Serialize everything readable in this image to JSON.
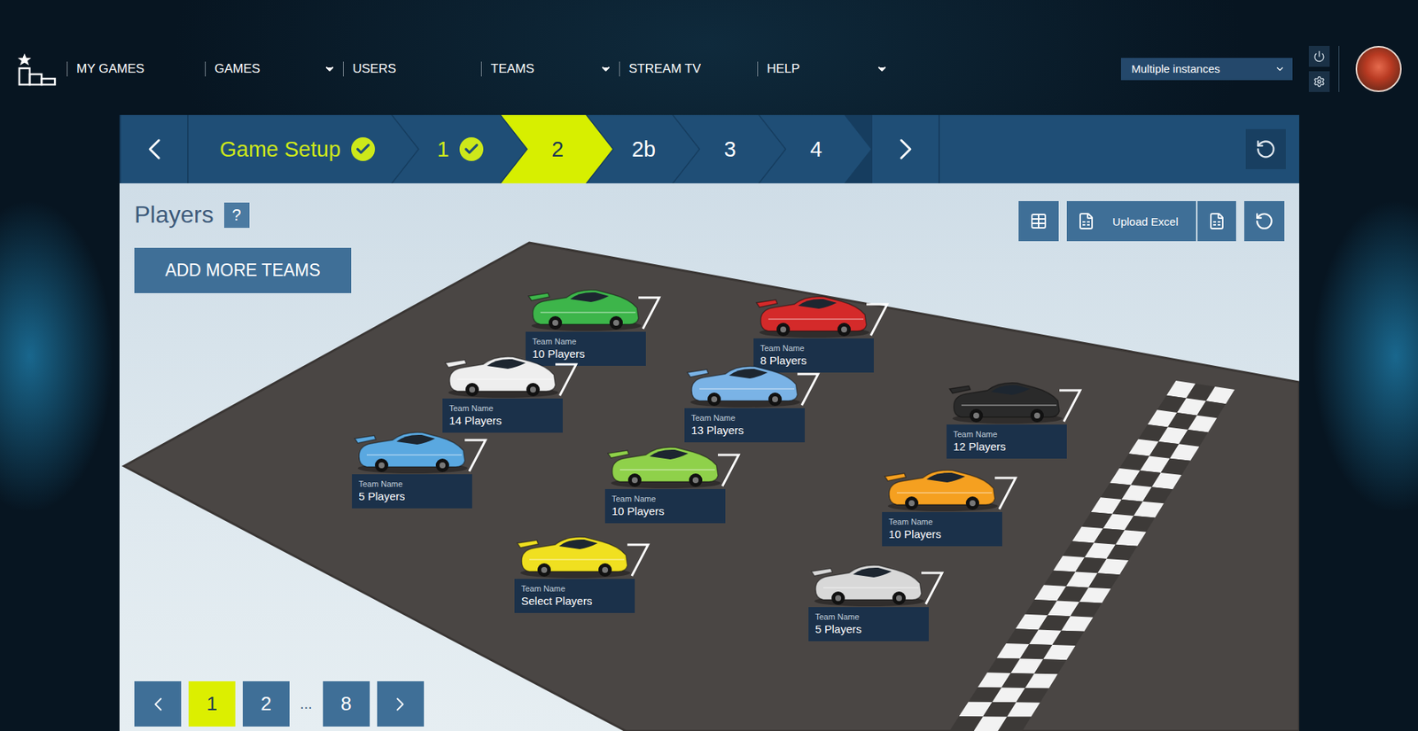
{
  "nav": {
    "items": [
      {
        "label": "MY GAMES",
        "dropdown": false
      },
      {
        "label": "GAMES",
        "dropdown": true
      },
      {
        "label": "USERS",
        "dropdown": false
      },
      {
        "label": "TEAMS",
        "dropdown": true
      },
      {
        "label": "STREAM TV",
        "dropdown": false
      },
      {
        "label": "HELP",
        "dropdown": true
      }
    ],
    "instance_select": "Multiple instances"
  },
  "steps": [
    {
      "label": "Game Setup",
      "done": true,
      "selected": false
    },
    {
      "label": "1",
      "done": true,
      "selected": false
    },
    {
      "label": "2",
      "done": false,
      "selected": true
    },
    {
      "label": "2b",
      "done": false,
      "selected": false
    },
    {
      "label": "3",
      "done": false,
      "selected": false
    },
    {
      "label": "4",
      "done": false,
      "selected": false
    }
  ],
  "page": {
    "title": "Players",
    "help": "?",
    "add_button": "ADD MORE TEAMS",
    "upload_button": "Upload Excel"
  },
  "teams": [
    {
      "name": "Team Name",
      "players": "10 Players",
      "color": "#3db54a"
    },
    {
      "name": "Team Name",
      "players": "8 Players",
      "color": "#d42a2a"
    },
    {
      "name": "Team Name",
      "players": "14 Players",
      "color": "#eeeeee"
    },
    {
      "name": "Team Name",
      "players": "13 Players",
      "color": "#7ab3e6"
    },
    {
      "name": "Team Name",
      "players": "12 Players",
      "color": "#2a2a2a"
    },
    {
      "name": "Team Name",
      "players": "5 Players",
      "color": "#5aa8e0"
    },
    {
      "name": "Team Name",
      "players": "10 Players",
      "color": "#8fd14a"
    },
    {
      "name": "Team Name",
      "players": "10 Players",
      "color": "#f5a020"
    },
    {
      "name": "Team Name",
      "players": "Select Players",
      "color": "#f0e020"
    },
    {
      "name": "Team Name",
      "players": "5 Players",
      "color": "#d8d8d8"
    }
  ],
  "pagination": [
    {
      "label": "1",
      "kind": "page",
      "selected": true
    },
    {
      "label": "2",
      "kind": "page",
      "selected": false
    },
    {
      "label": "...",
      "kind": "ellipsis",
      "selected": false
    },
    {
      "label": "8",
      "kind": "page",
      "selected": false
    }
  ]
}
